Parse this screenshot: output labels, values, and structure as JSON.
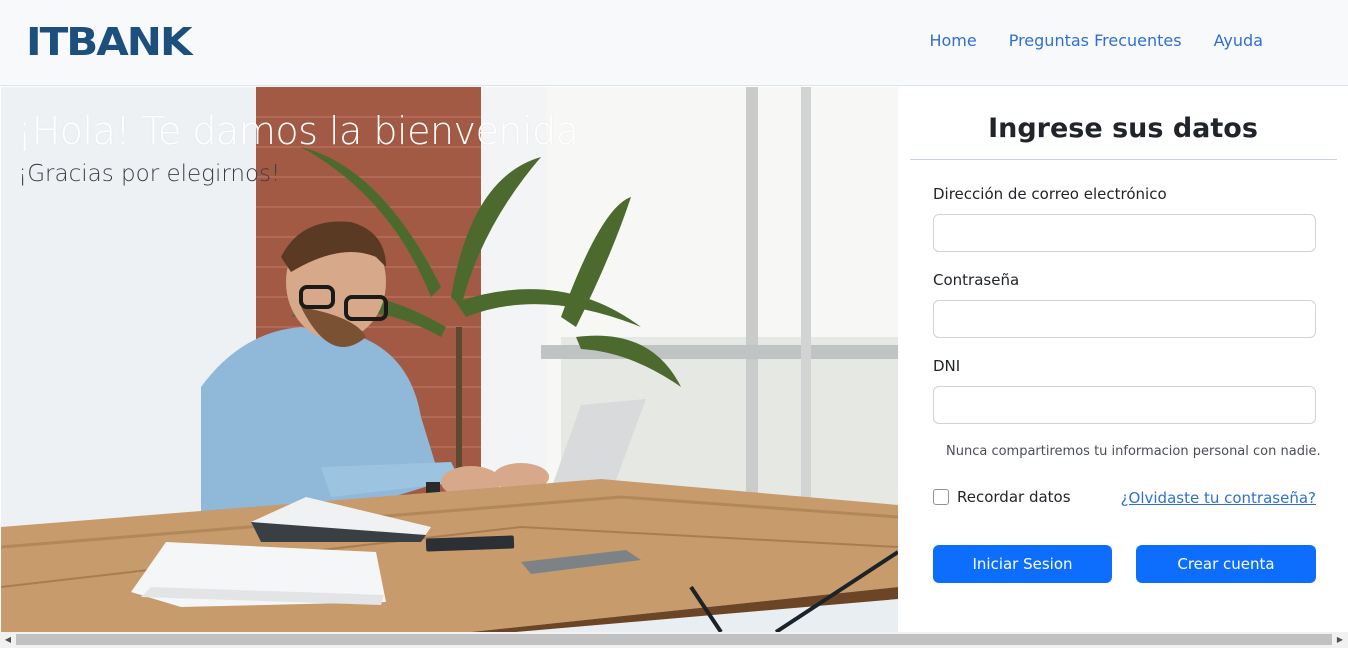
{
  "brand": {
    "logo_text": "ITBANK",
    "color": "#1d4f7c"
  },
  "nav": {
    "links": [
      "Home",
      "Preguntas Frecuentes",
      "Ayuda"
    ],
    "link_color": "#2f6fd4"
  },
  "hero": {
    "title": "¡Hola! Te damos la bienvenida",
    "subtitle": "¡Gracias por elegirnos!"
  },
  "form": {
    "title": "Ingrese sus datos",
    "email": {
      "label": "Dirección de correo electrónico",
      "value": "",
      "placeholder": ""
    },
    "password": {
      "label": "Contraseña",
      "value": "",
      "placeholder": ""
    },
    "dni": {
      "label": "DNI",
      "value": "",
      "placeholder": ""
    },
    "help_text": "Nunca compartiremos tu informacion personal con nadie.",
    "remember_label": "Recordar datos",
    "remember_checked": false,
    "forgot_link": "¿Olvidaste tu contraseña?",
    "login_button": "Iniciar Sesion",
    "signup_button": "Crear cuenta",
    "button_color": "#0d6efd"
  },
  "scrollbar": {
    "left_arrow": "◀",
    "right_arrow": "▶"
  }
}
